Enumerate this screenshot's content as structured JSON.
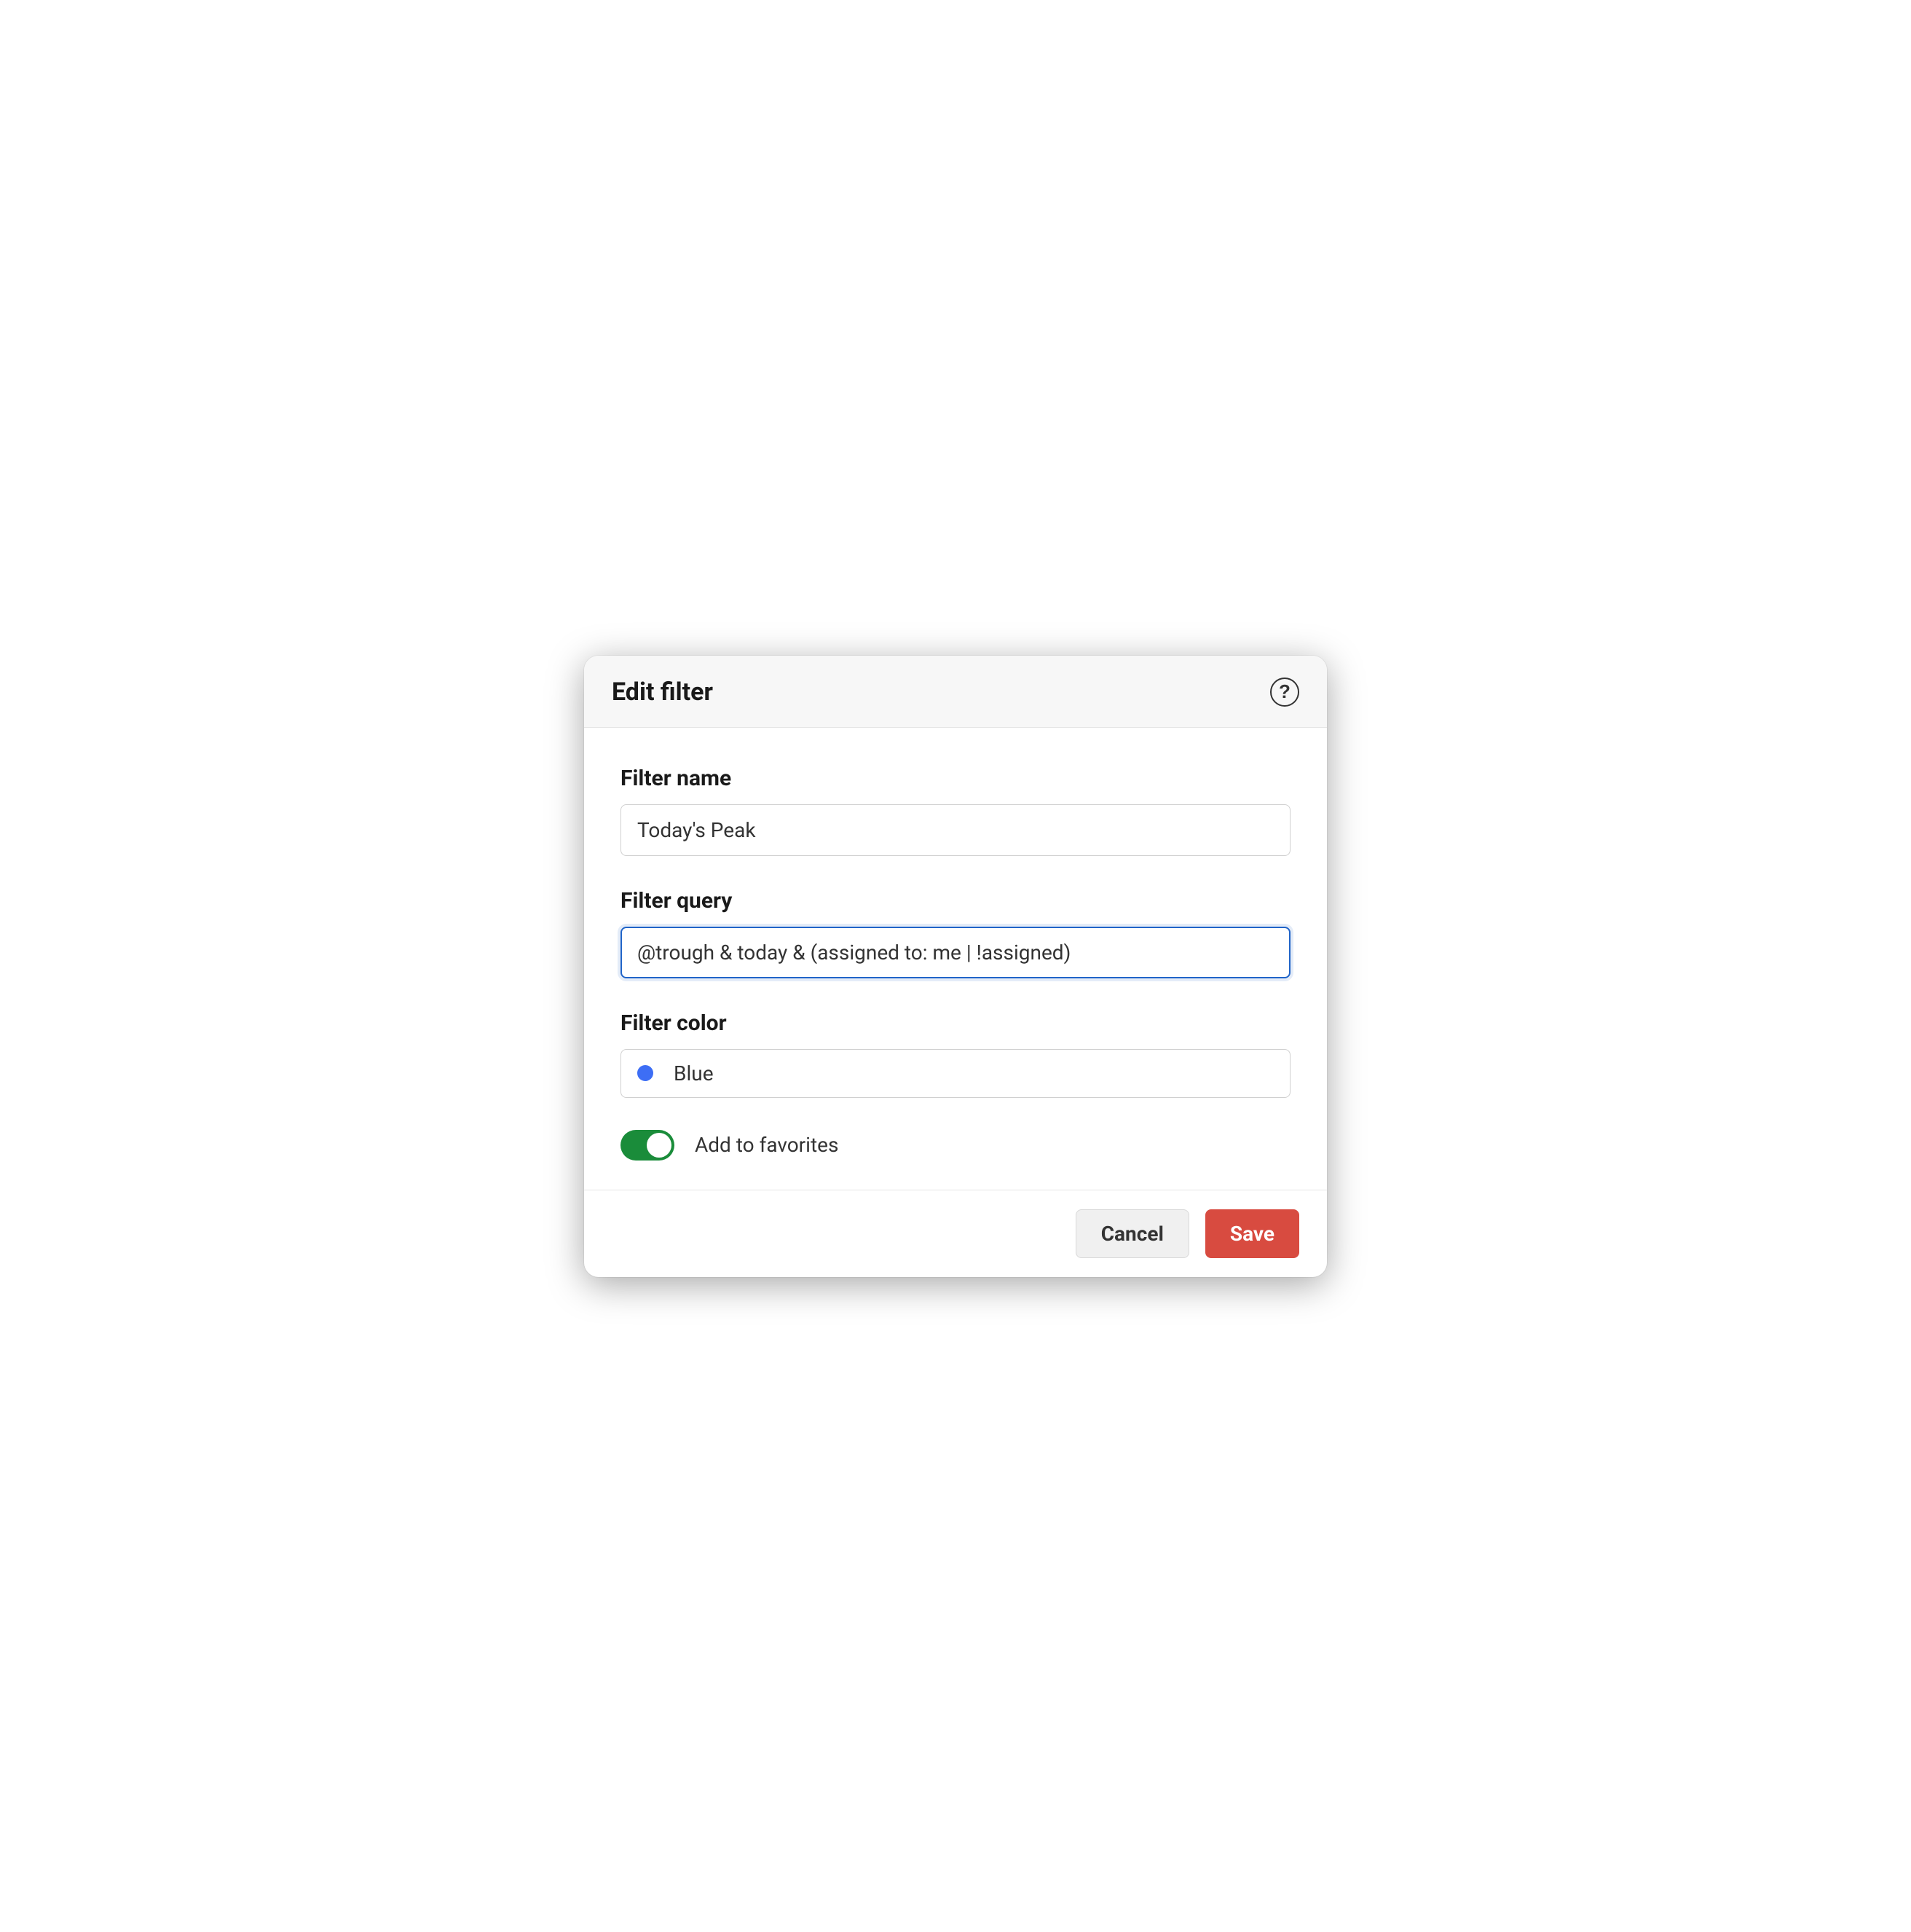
{
  "dialog": {
    "title": "Edit filter"
  },
  "fields": {
    "name": {
      "label": "Filter name",
      "value": "Today's Peak"
    },
    "query": {
      "label": "Filter query",
      "value": "@trough & today & (assigned to: me | !assigned)"
    },
    "color": {
      "label": "Filter color",
      "selected_name": "Blue",
      "selected_hex": "#3d6ef5"
    },
    "favorites": {
      "label": "Add to favorites",
      "enabled": true
    }
  },
  "footer": {
    "cancel_label": "Cancel",
    "save_label": "Save"
  }
}
